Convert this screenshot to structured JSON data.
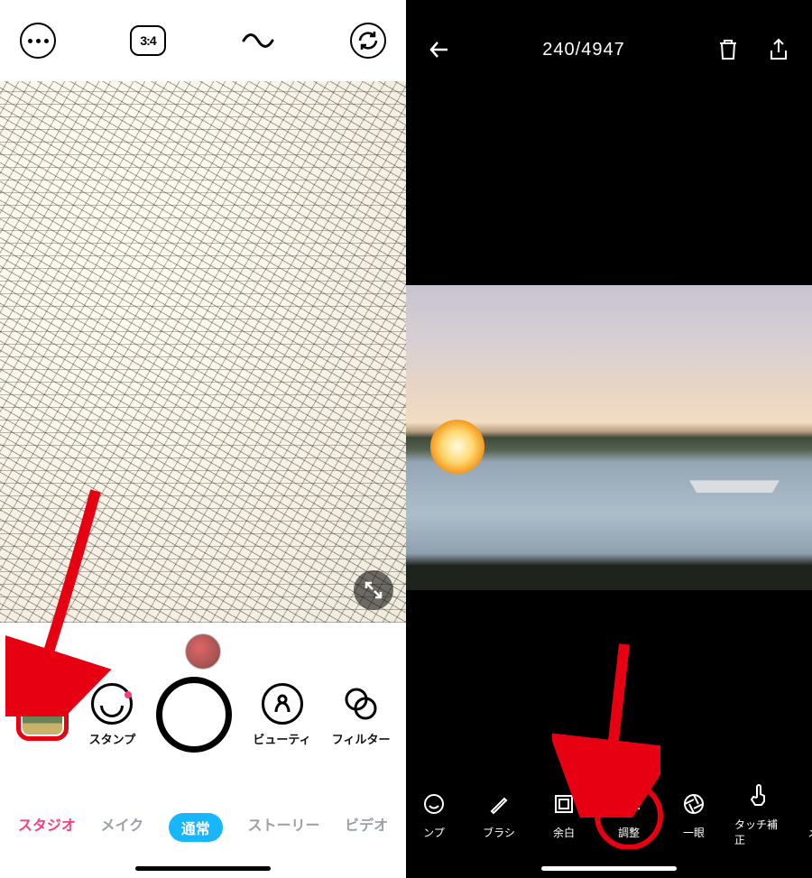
{
  "left": {
    "aspect_badge": "3:4",
    "tools": {
      "stamp_label": "スタンプ",
      "beauty_label": "ビューティ",
      "filter_label": "フィルター"
    },
    "modes": {
      "studio": "スタジオ",
      "makeup": "メイク",
      "normal": "通常",
      "story": "ストーリー",
      "video": "ビデオ"
    }
  },
  "right": {
    "counter": "240/4947",
    "tools": {
      "stamp": "ンプ",
      "brush": "ブラシ",
      "margin": "余白",
      "adjust": "調整",
      "dslr": "一眼",
      "touch": "タッチ補正",
      "makeup": "メイク"
    }
  },
  "annotation": {
    "arrow_color": "#e60012"
  }
}
